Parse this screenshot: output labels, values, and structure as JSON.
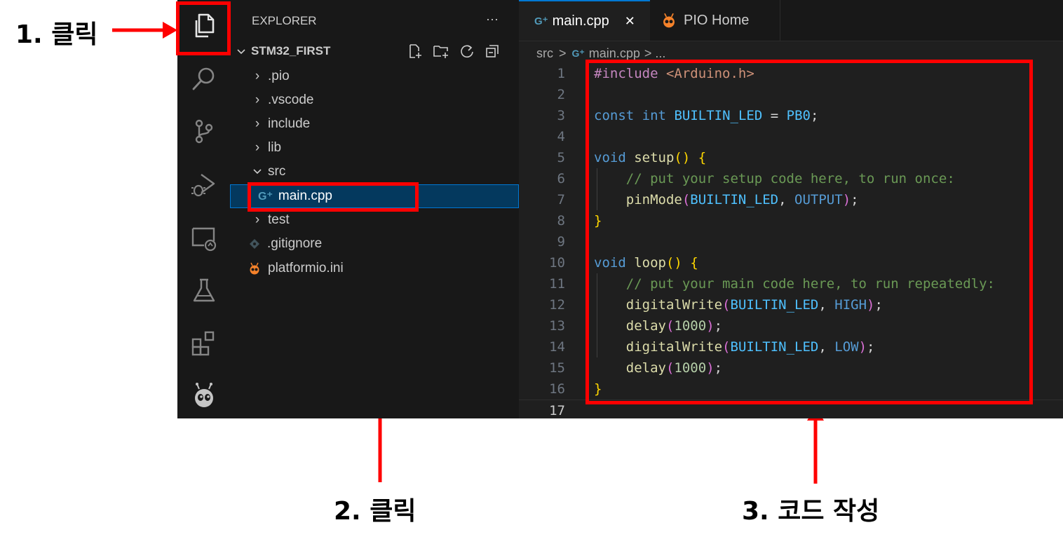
{
  "annotations": {
    "step1": "1. 클릭",
    "step2": "2. 클릭",
    "step3": "3. 코드 작성"
  },
  "activity_bar": {
    "icons": [
      "explorer-icon",
      "search-icon",
      "source-control-icon",
      "run-debug-icon",
      "remote-explorer-icon",
      "testing-icon",
      "extensions-icon",
      "platformio-icon"
    ]
  },
  "sidebar": {
    "title": "EXPLORER",
    "more": "···",
    "project": "STM32_FIRST",
    "items": [
      {
        "label": ".pio",
        "kind": "folder",
        "expanded": false
      },
      {
        "label": ".vscode",
        "kind": "folder",
        "expanded": false
      },
      {
        "label": "include",
        "kind": "folder",
        "expanded": false
      },
      {
        "label": "lib",
        "kind": "folder",
        "expanded": false
      },
      {
        "label": "src",
        "kind": "folder",
        "expanded": true
      },
      {
        "label": "main.cpp",
        "kind": "file-cpp",
        "selected": true
      },
      {
        "label": "test",
        "kind": "folder",
        "expanded": false
      },
      {
        "label": ".gitignore",
        "kind": "file-git"
      },
      {
        "label": "platformio.ini",
        "kind": "file-pio"
      }
    ]
  },
  "editor": {
    "tabs": [
      {
        "label": "main.cpp",
        "active": true,
        "close": "✕"
      },
      {
        "label": "PIO Home",
        "active": false
      }
    ],
    "breadcrumb": {
      "folder": "src",
      "sep": ">",
      "file": "main.cpp",
      "tail": "> ..."
    },
    "line_numbers": [
      "1",
      "2",
      "3",
      "4",
      "5",
      "6",
      "7",
      "8",
      "9",
      "10",
      "11",
      "12",
      "13",
      "14",
      "15",
      "16",
      "17"
    ],
    "current_line": "17"
  },
  "colors": {
    "annotation_red": "#ff0000",
    "editor_bg": "#1f1f1f",
    "sidebar_bg": "#181818",
    "selection": "#04395e",
    "selection_border": "#0078d4"
  }
}
